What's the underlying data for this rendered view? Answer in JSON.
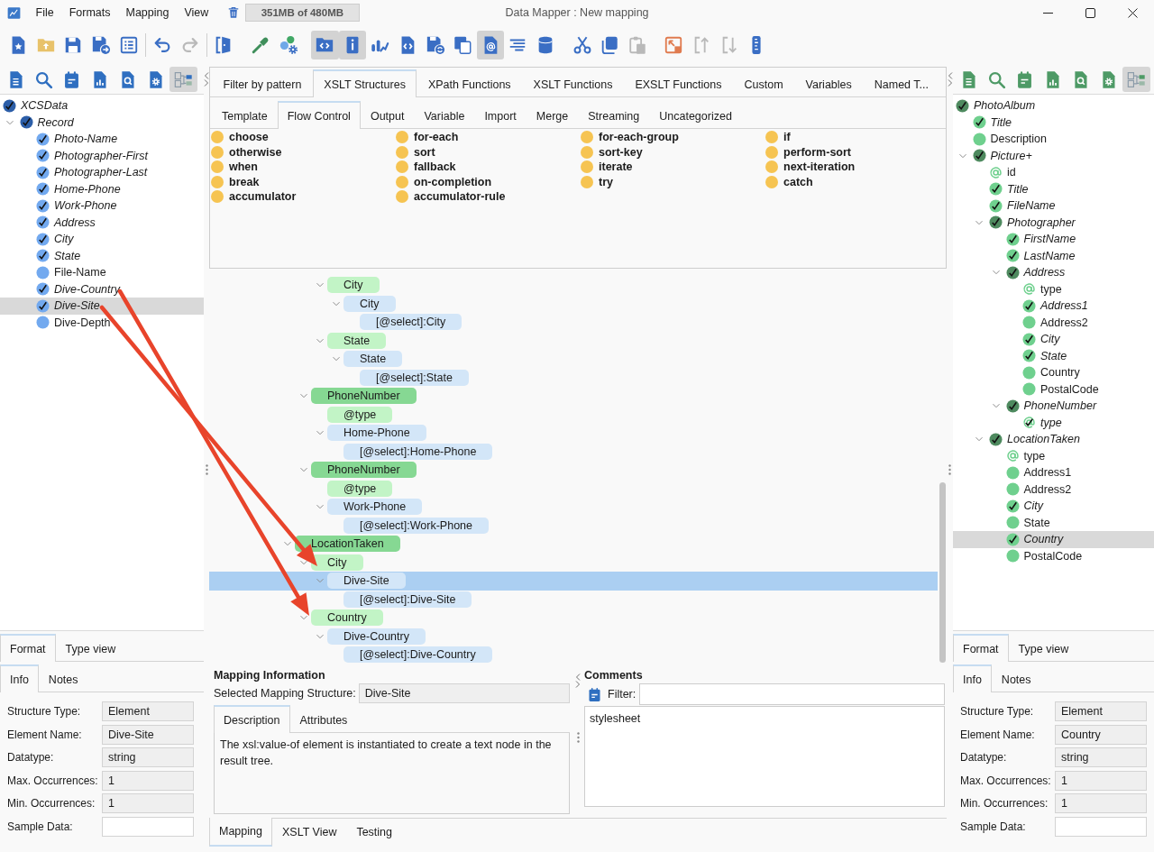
{
  "title_bar": {
    "menu": [
      "File",
      "Formats",
      "Mapping",
      "View"
    ],
    "memory": "351MB of 480MB",
    "title": "Data Mapper : New mapping"
  },
  "toolbar": {
    "groups": [
      {
        "divider": true,
        "buttons": [
          {
            "kind": "new-file",
            "pressed": false,
            "disabled": false
          },
          {
            "kind": "open-folder",
            "pressed": false,
            "disabled": false
          },
          {
            "kind": "save",
            "pressed": false,
            "disabled": false
          },
          {
            "kind": "save-as",
            "pressed": false,
            "disabled": false
          },
          {
            "kind": "list",
            "pressed": false,
            "disabled": false
          }
        ]
      },
      {
        "divider": true,
        "buttons": [
          {
            "kind": "undo",
            "pressed": false,
            "disabled": false
          },
          {
            "kind": "redo",
            "pressed": false,
            "disabled": true
          }
        ]
      },
      {
        "divider": false,
        "buttons": [
          {
            "kind": "panel-door",
            "pressed": false,
            "disabled": false
          }
        ]
      },
      {
        "divider": false,
        "buttons": [
          {
            "kind": "eyedropper",
            "pressed": false,
            "disabled": false
          },
          {
            "kind": "users-gear",
            "pressed": false,
            "disabled": false
          }
        ]
      },
      {
        "divider": false,
        "buttons": [
          {
            "kind": "code-folder",
            "pressed": true,
            "disabled": false
          },
          {
            "kind": "info",
            "pressed": true,
            "disabled": false
          },
          {
            "kind": "chart",
            "pressed": false,
            "disabled": false
          },
          {
            "kind": "code-file",
            "pressed": false,
            "disabled": false
          },
          {
            "kind": "save-sync",
            "pressed": false,
            "disabled": false
          },
          {
            "kind": "windows",
            "pressed": false,
            "disabled": false
          },
          {
            "kind": "at-file",
            "pressed": true,
            "disabled": false
          },
          {
            "kind": "text-lines",
            "pressed": false,
            "disabled": false
          },
          {
            "kind": "database",
            "pressed": false,
            "disabled": false
          }
        ]
      },
      {
        "divider": false,
        "buttons": [
          {
            "kind": "cut",
            "pressed": false,
            "disabled": false
          },
          {
            "kind": "copy",
            "pressed": false,
            "disabled": false
          },
          {
            "kind": "paste",
            "pressed": false,
            "disabled": true
          }
        ]
      },
      {
        "divider": false,
        "buttons": [
          {
            "kind": "expand",
            "pressed": false,
            "disabled": false
          },
          {
            "kind": "move-up",
            "pressed": false,
            "disabled": true
          },
          {
            "kind": "move-down",
            "pressed": false,
            "disabled": true
          },
          {
            "kind": "ruler",
            "pressed": false,
            "disabled": false
          }
        ]
      }
    ]
  },
  "source": {
    "tools": [
      {
        "kind": "document",
        "pressed": false
      },
      {
        "kind": "search",
        "pressed": false
      },
      {
        "kind": "notepad",
        "pressed": false
      },
      {
        "kind": "chart-doc",
        "pressed": false
      },
      {
        "kind": "search-doc",
        "pressed": false
      },
      {
        "kind": "gear-doc",
        "pressed": false
      },
      {
        "kind": "tree-view",
        "pressed": true
      }
    ],
    "tree": {
      "label": "XCSData",
      "kind": "complex",
      "mapped": true,
      "selected": false,
      "children": [
        {
          "label": "Record",
          "kind": "complex",
          "mapped": true,
          "selected": false,
          "expanded": true,
          "children": [
            {
              "label": "Photo-Name",
              "kind": "simple",
              "mapped": true,
              "selected": false
            },
            {
              "label": "Photographer-First",
              "kind": "simple",
              "mapped": true,
              "selected": false
            },
            {
              "label": "Photographer-Last",
              "kind": "simple",
              "mapped": true,
              "selected": false
            },
            {
              "label": "Home-Phone",
              "kind": "simple",
              "mapped": true,
              "selected": false
            },
            {
              "label": "Work-Phone",
              "kind": "simple",
              "mapped": true,
              "selected": false
            },
            {
              "label": "Address",
              "kind": "simple",
              "mapped": true,
              "selected": false
            },
            {
              "label": "City",
              "kind": "simple",
              "mapped": true,
              "selected": false
            },
            {
              "label": "State",
              "kind": "simple",
              "mapped": true,
              "selected": false
            },
            {
              "label": "File-Name",
              "kind": "simple",
              "mapped": false,
              "selected": false
            },
            {
              "label": "Dive-Country",
              "kind": "simple",
              "mapped": true,
              "selected": false
            },
            {
              "label": "Dive-Site",
              "kind": "simple",
              "mapped": true,
              "selected": true
            },
            {
              "label": "Dive-Depth",
              "kind": "simple",
              "mapped": false,
              "selected": false
            }
          ]
        }
      ]
    },
    "tabs": [
      {
        "label": "Format",
        "selected": true
      },
      {
        "label": "Type view",
        "selected": false
      }
    ],
    "subtabs": [
      {
        "label": "Info",
        "selected": true
      },
      {
        "label": "Notes",
        "selected": false
      }
    ],
    "fields": [
      {
        "label": "Structure Type:",
        "value": "Element",
        "readonly": true
      },
      {
        "label": "Element Name:",
        "value": "Dive-Site",
        "readonly": true
      },
      {
        "label": "Datatype:",
        "value": "string",
        "readonly": true
      },
      {
        "label": "Max. Occurrences:",
        "value": "1",
        "readonly": true
      },
      {
        "label": "Min. Occurrences:",
        "value": "1",
        "readonly": true
      },
      {
        "label": "Sample Data:",
        "readonly": false
      }
    ]
  },
  "palette": {
    "tabs": [
      {
        "label": "Filter by pattern",
        "selected": false
      },
      {
        "label": "XSLT Structures",
        "selected": true
      },
      {
        "label": "XPath Functions",
        "selected": false
      },
      {
        "label": "XSLT Functions",
        "selected": false
      },
      {
        "label": "EXSLT Functions",
        "selected": false
      },
      {
        "label": "Custom",
        "selected": false
      },
      {
        "label": "Variables",
        "selected": false
      },
      {
        "label": "Named T...",
        "selected": false
      }
    ],
    "subtabs": [
      {
        "label": "Template",
        "selected": false
      },
      {
        "label": "Flow Control",
        "selected": true
      },
      {
        "label": "Output",
        "selected": false
      },
      {
        "label": "Variable",
        "selected": false
      },
      {
        "label": "Import",
        "selected": false
      },
      {
        "label": "Merge",
        "selected": false
      },
      {
        "label": "Streaming",
        "selected": false
      },
      {
        "label": "Uncategorized",
        "selected": false
      }
    ],
    "items": [
      "choose",
      "for-each",
      "for-each-group",
      "if",
      "otherwise",
      "sort",
      "sort-key",
      "perform-sort",
      "when",
      "fallback",
      "iterate",
      "next-iteration",
      "break",
      "on-completion",
      "try",
      "catch",
      "accumulator",
      "accumulator-rule"
    ]
  },
  "mapping_tree": {
    "nodes": [
      {
        "children": [
          {
            "children": [
              {
                "label": "City",
                "kind": "simple",
                "expanded": true,
                "selected": false,
                "children": [
                  {
                    "label": "City",
                    "kind": "source",
                    "expanded": true,
                    "selected": false,
                    "children": [
                      {
                        "label": "[@select]:City",
                        "kind": "source",
                        "selected": false
                      }
                    ]
                  }
                ]
              },
              {
                "label": "State",
                "kind": "simple",
                "expanded": true,
                "selected": false,
                "children": [
                  {
                    "label": "State",
                    "kind": "source",
                    "expanded": true,
                    "selected": false,
                    "children": [
                      {
                        "label": "[@select]:State",
                        "kind": "source",
                        "selected": false
                      }
                    ]
                  }
                ]
              }
            ]
          },
          {
            "label": "PhoneNumber",
            "kind": "complex",
            "expanded": true,
            "selected": false,
            "children": [
              {
                "label": "@type",
                "kind": "simple",
                "selected": false
              },
              {
                "label": "Home-Phone",
                "kind": "source",
                "expanded": true,
                "selected": false,
                "children": [
                  {
                    "label": "[@select]:Home-Phone",
                    "kind": "source",
                    "selected": false
                  }
                ]
              }
            ]
          },
          {
            "label": "PhoneNumber",
            "kind": "complex",
            "expanded": true,
            "selected": false,
            "children": [
              {
                "label": "@type",
                "kind": "simple",
                "selected": false
              },
              {
                "label": "Work-Phone",
                "kind": "source",
                "expanded": true,
                "selected": false,
                "children": [
                  {
                    "label": "[@select]:Work-Phone",
                    "kind": "source",
                    "selected": false
                  }
                ]
              }
            ]
          }
        ]
      },
      {
        "label": "LocationTaken",
        "kind": "complex",
        "expanded": true,
        "selected": false,
        "children": [
          {
            "label": "City",
            "kind": "simple",
            "expanded": true,
            "selected": false,
            "children": [
              {
                "label": "Dive-Site",
                "kind": "source",
                "expanded": true,
                "selected": true,
                "children": [
                  {
                    "label": "[@select]:Dive-Site",
                    "kind": "source",
                    "selected": false
                  }
                ]
              }
            ]
          },
          {
            "label": "Country",
            "kind": "simple",
            "expanded": true,
            "selected": false,
            "children": [
              {
                "label": "Dive-Country",
                "kind": "source",
                "expanded": true,
                "selected": false,
                "children": [
                  {
                    "label": "[@select]:Dive-Country",
                    "kind": "source",
                    "selected": false
                  }
                ]
              }
            ]
          }
        ]
      }
    ]
  },
  "mapping_info": {
    "title": "Mapping Information",
    "structure_label": "Selected Mapping Structure:",
    "structure_value": "Dive-Site",
    "tabs": [
      {
        "label": "Description",
        "selected": true
      },
      {
        "label": "Attributes",
        "selected": false
      }
    ],
    "description": "The xsl:value-of element is instantiated to create a text node in the result tree."
  },
  "comments": {
    "title": "Comments",
    "filter_label": "Filter:",
    "text": "stylesheet"
  },
  "bottom_tabs": [
    {
      "label": "Mapping",
      "selected": true
    },
    {
      "label": "XSLT View",
      "selected": false
    },
    {
      "label": "Testing",
      "selected": false
    }
  ],
  "target": {
    "tools": [
      {
        "kind": "document",
        "pressed": false
      },
      {
        "kind": "search",
        "pressed": false
      },
      {
        "kind": "notepad",
        "pressed": false
      },
      {
        "kind": "chart-doc",
        "pressed": false
      },
      {
        "kind": "search-doc",
        "pressed": false
      },
      {
        "kind": "gear-doc",
        "pressed": false
      },
      {
        "kind": "tree-view",
        "pressed": true
      }
    ],
    "tree": {
      "label": "PhotoAlbum",
      "kind": "complex",
      "mapped": true,
      "selected": false,
      "children": [
        {
          "label": "Title",
          "kind": "simple",
          "mapped": true,
          "selected": false
        },
        {
          "label": "Description",
          "kind": "simple",
          "mapped": false,
          "selected": false
        },
        {
          "label": "Picture+",
          "kind": "complex",
          "mapped": true,
          "selected": false,
          "expanded": true,
          "children": [
            {
              "label": "id",
              "kind": "attribute",
              "mapped": false,
              "selected": false
            },
            {
              "label": "Title",
              "kind": "simple",
              "mapped": true,
              "selected": false
            },
            {
              "label": "FileName",
              "kind": "simple",
              "mapped": true,
              "selected": false
            },
            {
              "label": "Photographer",
              "kind": "complex",
              "mapped": true,
              "selected": false,
              "expanded": true,
              "children": [
                {
                  "label": "FirstName",
                  "kind": "simple",
                  "mapped": true,
                  "selected": false
                },
                {
                  "label": "LastName",
                  "kind": "simple",
                  "mapped": true,
                  "selected": false
                },
                {
                  "label": "Address",
                  "kind": "complex",
                  "mapped": true,
                  "selected": false,
                  "expanded": true,
                  "children": [
                    {
                      "label": "type",
                      "kind": "attribute",
                      "mapped": false,
                      "selected": false
                    },
                    {
                      "label": "Address1",
                      "kind": "simple",
                      "mapped": true,
                      "selected": false
                    },
                    {
                      "label": "Address2",
                      "kind": "simple",
                      "mapped": false,
                      "selected": false
                    },
                    {
                      "label": "City",
                      "kind": "simple",
                      "mapped": true,
                      "selected": false
                    },
                    {
                      "label": "State",
                      "kind": "simple",
                      "mapped": true,
                      "selected": false
                    },
                    {
                      "label": "Country",
                      "kind": "simple",
                      "mapped": false,
                      "selected": false
                    },
                    {
                      "label": "PostalCode",
                      "kind": "simple",
                      "mapped": false,
                      "selected": false
                    }
                  ]
                },
                {
                  "label": "PhoneNumber",
                  "kind": "complex",
                  "mapped": true,
                  "selected": false,
                  "expanded": true,
                  "children": [
                    {
                      "label": "type",
                      "kind": "attribute",
                      "mapped": true,
                      "selected": false
                    }
                  ]
                }
              ]
            },
            {
              "label": "LocationTaken",
              "kind": "complex",
              "mapped": true,
              "selected": false,
              "expanded": true,
              "children": [
                {
                  "label": "type",
                  "kind": "attribute",
                  "mapped": false,
                  "selected": false
                },
                {
                  "label": "Address1",
                  "kind": "simple",
                  "mapped": false,
                  "selected": false
                },
                {
                  "label": "Address2",
                  "kind": "simple",
                  "mapped": false,
                  "selected": false
                },
                {
                  "label": "City",
                  "kind": "simple",
                  "mapped": true,
                  "selected": false
                },
                {
                  "label": "State",
                  "kind": "simple",
                  "mapped": false,
                  "selected": false
                },
                {
                  "label": "Country",
                  "kind": "simple",
                  "mapped": true,
                  "selected": true
                },
                {
                  "label": "PostalCode",
                  "kind": "simple",
                  "mapped": false,
                  "selected": false
                }
              ]
            }
          ]
        }
      ]
    },
    "tabs": [
      {
        "label": "Format",
        "selected": true
      },
      {
        "label": "Type view",
        "selected": false
      }
    ],
    "subtabs": [
      {
        "label": "Info",
        "selected": true
      },
      {
        "label": "Notes",
        "selected": false
      }
    ],
    "fields": [
      {
        "label": "Structure Type:",
        "value": "Element",
        "readonly": true
      },
      {
        "label": "Element Name:",
        "value": "Country",
        "readonly": true
      },
      {
        "label": "Datatype:",
        "value": "string",
        "readonly": true
      },
      {
        "label": "Max. Occurrences:",
        "value": "1",
        "readonly": true
      },
      {
        "label": "Min. Occurrences:",
        "value": "1",
        "readonly": true
      },
      {
        "label": "Sample Data:",
        "readonly": false
      }
    ]
  }
}
